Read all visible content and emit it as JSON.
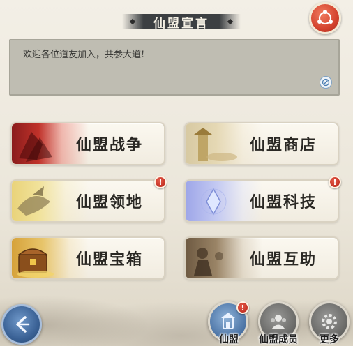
{
  "header": {
    "title": "仙盟宣言"
  },
  "declaration": {
    "text": "欢迎各位道友加入，共参大道!"
  },
  "features": [
    {
      "label": "仙盟战争",
      "art": "war-battle-art",
      "badge": ""
    },
    {
      "label": "仙盟商店",
      "art": "shop-pagoda-art",
      "badge": ""
    },
    {
      "label": "仙盟领地",
      "art": "territory-dragon-art",
      "badge": "!"
    },
    {
      "label": "仙盟科技",
      "art": "tech-crystal-art",
      "badge": "!"
    },
    {
      "label": "仙盟宝箱",
      "art": "treasure-chest-art",
      "badge": ""
    },
    {
      "label": "仙盟互助",
      "art": "mutual-aid-art",
      "badge": ""
    }
  ],
  "bottom_nav": {
    "alliance": {
      "label": "仙盟",
      "badge": "!"
    },
    "members": {
      "label": "仙盟成员"
    },
    "more": {
      "label": "更多"
    }
  },
  "colors": {
    "accent_red": "#d4432e",
    "badge_red": "#b62217",
    "back_blue": "#3b6296"
  },
  "icons": {
    "share": "share-icon",
    "edit": "edit-icon",
    "back": "back-arrow-icon"
  }
}
